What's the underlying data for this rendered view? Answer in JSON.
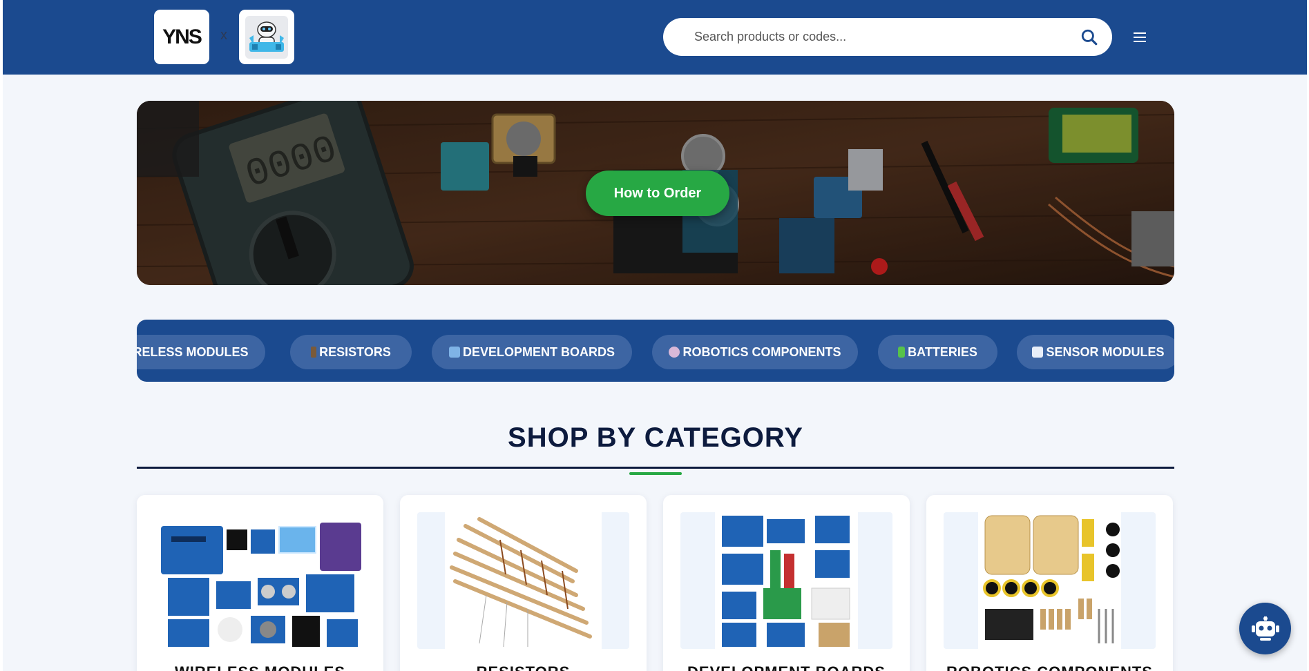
{
  "header": {
    "logo_left_text": "YNS",
    "logo_separator": "x",
    "search_placeholder": "Search products or codes...",
    "icons": [
      "search-icon",
      "menu-icon"
    ]
  },
  "hero": {
    "button_label": "How to Order"
  },
  "category_strip": {
    "chips": [
      {
        "label": "RELESS MODULES",
        "icon": "",
        "icon_color": ""
      },
      {
        "label": "RESISTORS",
        "icon": "probe-icon",
        "icon_color": "#7a5a3a"
      },
      {
        "label": "DEVELOPMENT BOARDS",
        "icon": "laptop-icon",
        "icon_color": "#7fb3e6"
      },
      {
        "label": "ROBOTICS COMPONENTS",
        "icon": "robot-icon",
        "icon_color": "#d9b8d8"
      },
      {
        "label": "BATTERIES",
        "icon": "battery-icon",
        "icon_color": "#57c24a"
      },
      {
        "label": "SENSOR MODULES",
        "icon": "chart-icon",
        "icon_color": "#e8eef8"
      }
    ]
  },
  "section": {
    "title": "SHOP BY CATEGORY"
  },
  "cards": [
    {
      "label": "WIRELESS MODULES"
    },
    {
      "label": "RESISTORS"
    },
    {
      "label": "DEVELOPMENT BOARDS"
    },
    {
      "label": "ROBOTICS COMPONENTS"
    }
  ],
  "colors": {
    "brand_blue": "#1b4a8f",
    "accent_green": "#27a844",
    "title_navy": "#0d1b3e"
  },
  "chat_button": {
    "icon": "robot-icon"
  }
}
